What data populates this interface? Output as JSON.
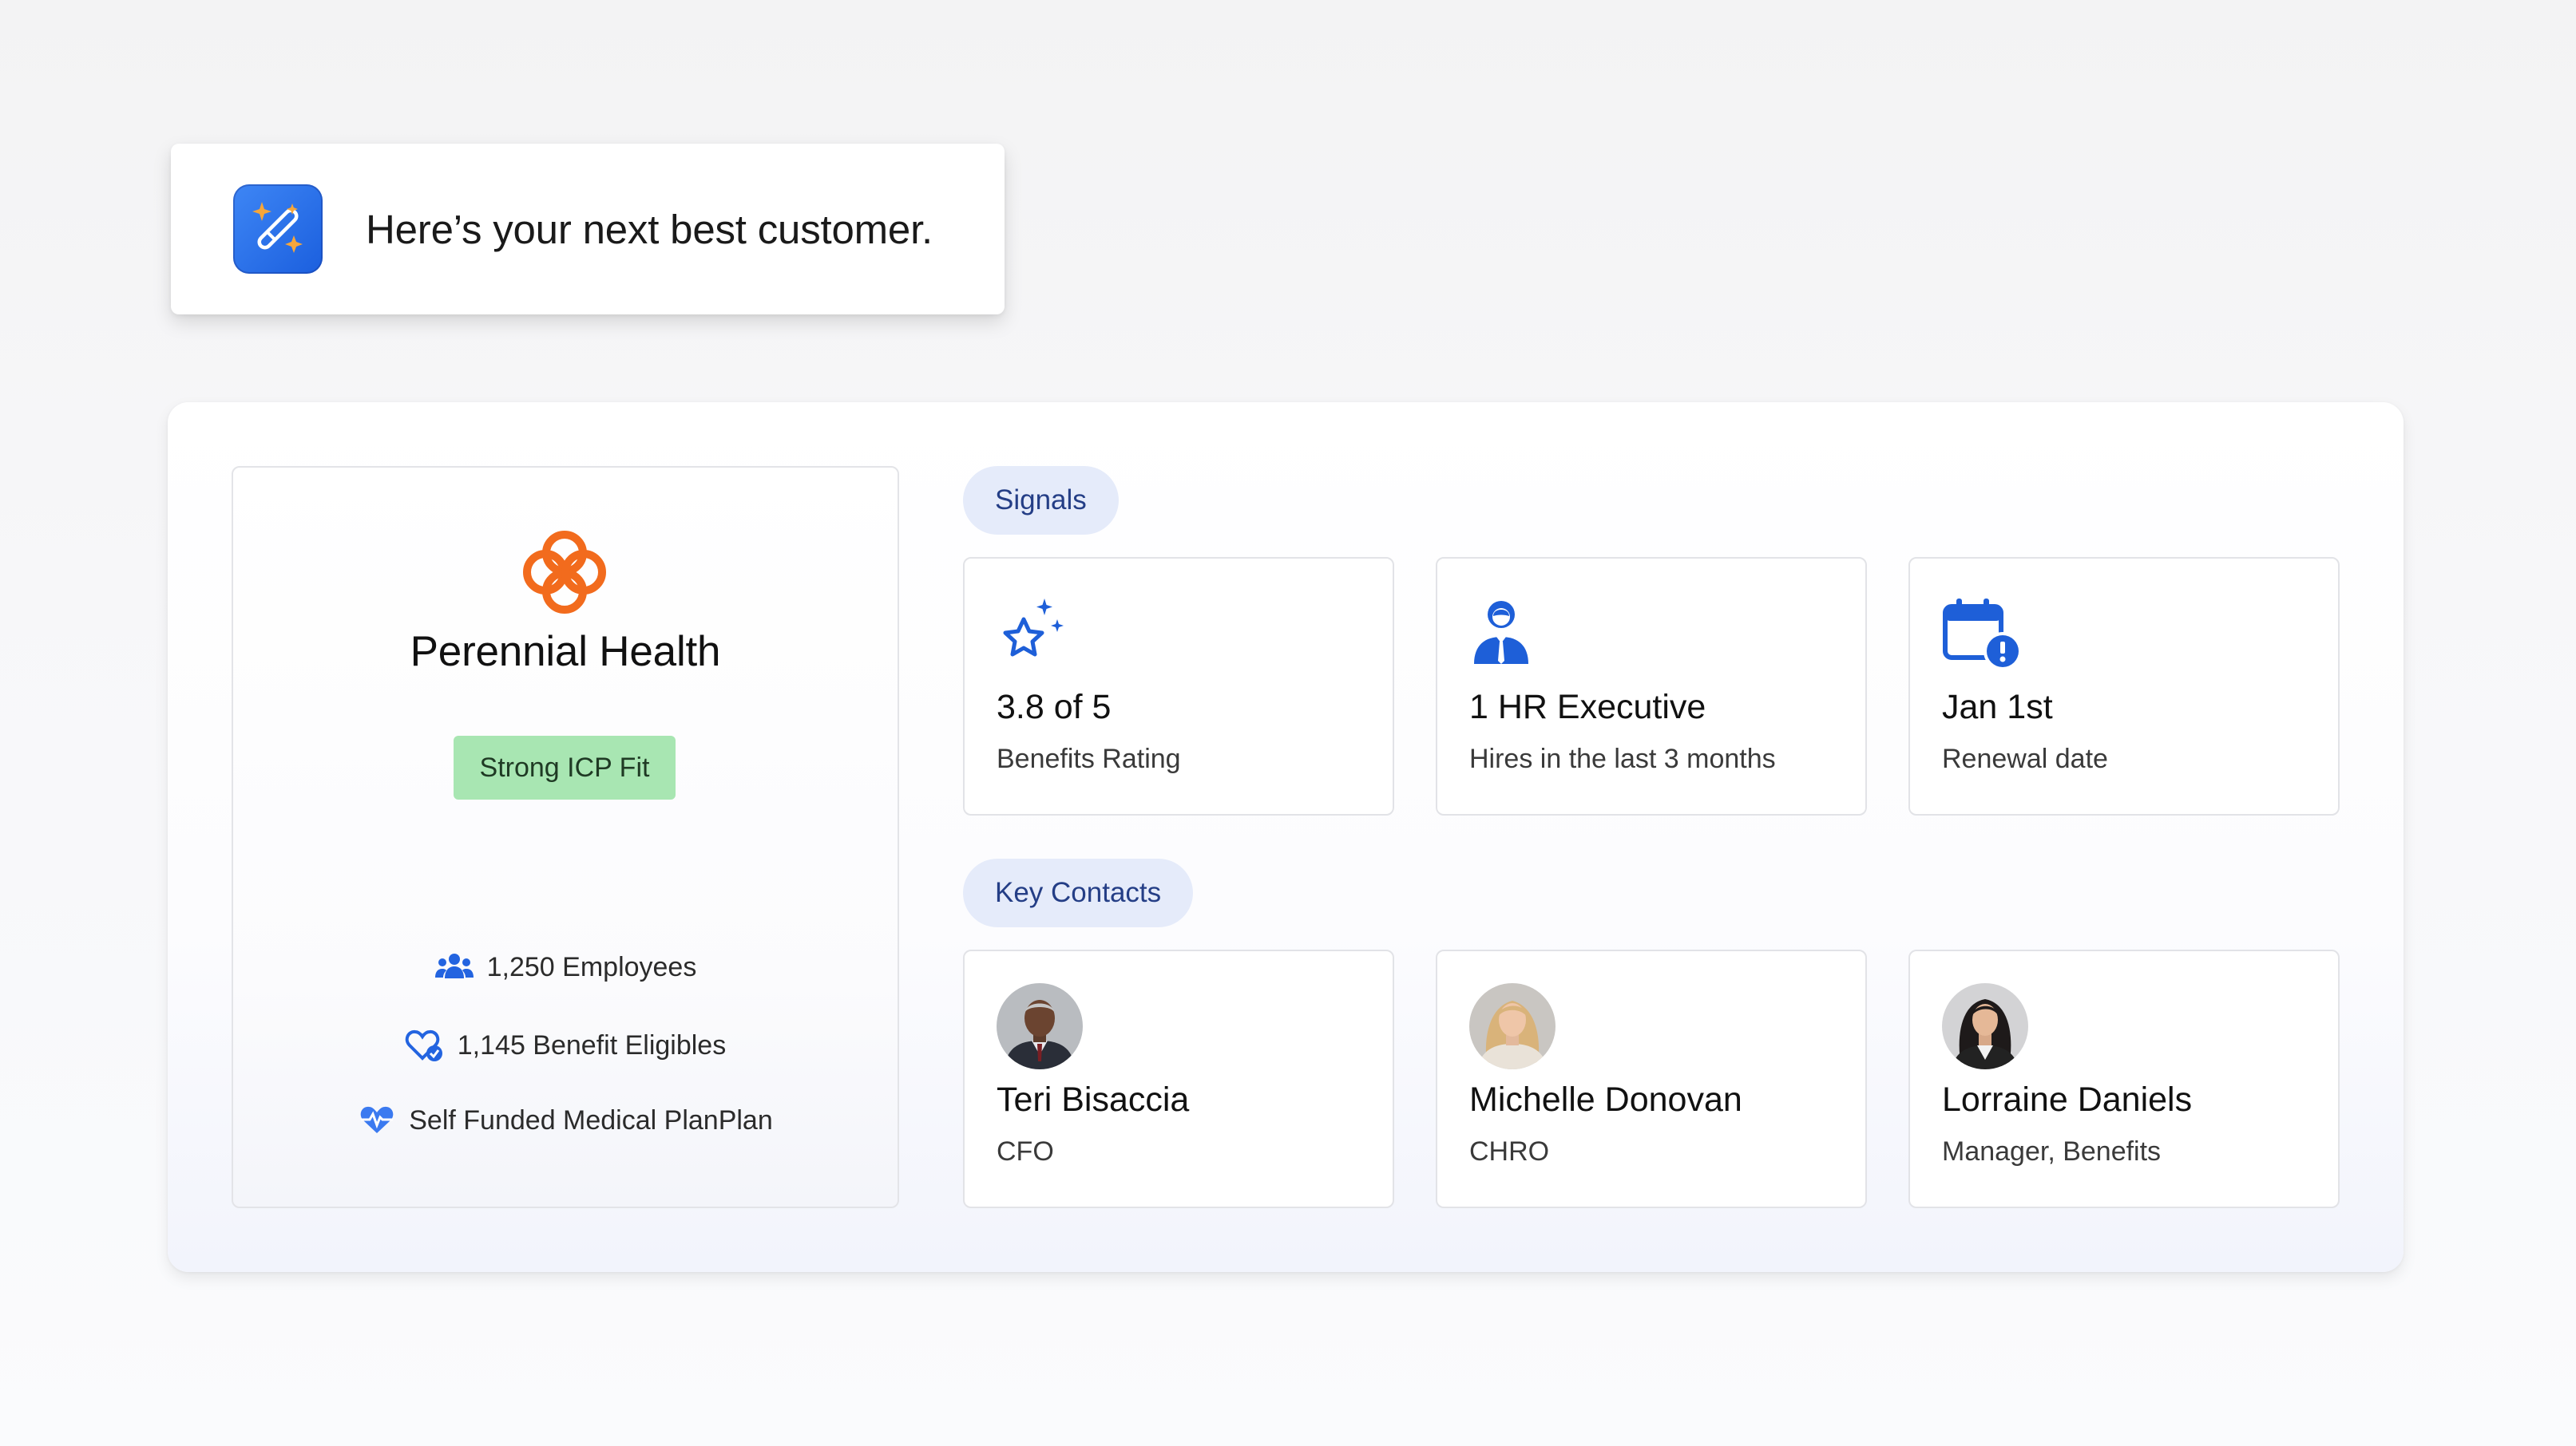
{
  "banner": {
    "icon": "magic-wand-sparkles-icon",
    "text": "Here’s your next best customer."
  },
  "company": {
    "logo_icon": "flower-logo-icon",
    "name": "Perennial Health",
    "fit_badge": "Strong ICP Fit",
    "stats": [
      {
        "icon": "people-icon",
        "text": "1,250 Employees"
      },
      {
        "icon": "heart-check-icon",
        "text": "1,145 Benefit Eligibles"
      },
      {
        "icon": "heart-pulse-icon",
        "text": "Self Funded Medical PlanPlan"
      }
    ]
  },
  "signals": {
    "label": "Signals",
    "items": [
      {
        "icon": "star-sparkle-icon",
        "value": "3.8 of 5",
        "label": "Benefits Rating"
      },
      {
        "icon": "hr-executive-icon",
        "value": "1 HR Executive",
        "label": "Hires in the last 3 months"
      },
      {
        "icon": "calendar-alert-icon",
        "value": "Jan 1st",
        "label": "Renewal date"
      }
    ]
  },
  "contacts": {
    "label": "Key Contacts",
    "items": [
      {
        "name": "Teri Bisaccia",
        "title": "CFO"
      },
      {
        "name": "Michelle Donovan",
        "title": "CHRO"
      },
      {
        "name": "Lorraine Daniels",
        "title": "Manager, Benefits"
      }
    ]
  },
  "colors": {
    "accent_blue": "#1e5fd8",
    "logo_orange": "#f26b1d",
    "badge_green": "#a8e6b2",
    "pill_bg": "#e5ebfa"
  }
}
